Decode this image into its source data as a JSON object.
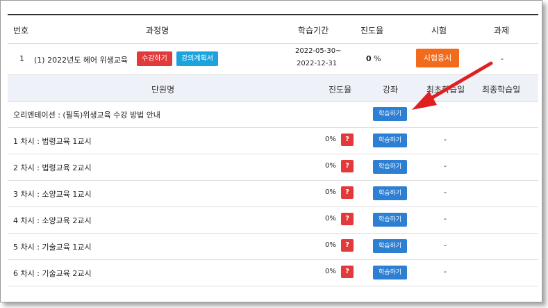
{
  "header": {
    "col_no": "번호",
    "col_course": "과정명",
    "col_period": "학습기간",
    "col_progress": "진도율",
    "col_exam": "시험",
    "col_assignment": "과제"
  },
  "course": {
    "no": "1",
    "name": "(1) 2022년도 헤어 위생교육",
    "enroll_label": "수강하기",
    "plan_label": "강의계획서",
    "period_start": "2022-05-30~",
    "period_end": "2022-12-31",
    "progress_value": "0",
    "progress_unit": " %",
    "exam_label": "시험응시",
    "assignment": "-"
  },
  "units_header": {
    "col_unit": "단원명",
    "col_progress": "진도율",
    "col_lecture": "강좌",
    "col_first": "최초학습일",
    "col_last": "최종학습일"
  },
  "units": [
    {
      "title": "오리엔테이션 : (필독)위생교육 수강 방법 안내",
      "progress": "",
      "study": "학습하기",
      "first": "",
      "last": ""
    },
    {
      "title": "1 차시 :  법령교육 1교시",
      "progress": "0%",
      "help": "?",
      "study": "학습하기",
      "first": "-",
      "last": ""
    },
    {
      "title": "2 차시 :  법령교육 2교시",
      "progress": "0%",
      "help": "?",
      "study": "학습하기",
      "first": "-",
      "last": ""
    },
    {
      "title": "3 차시 :  소양교육 1교시",
      "progress": "0%",
      "help": "?",
      "study": "학습하기",
      "first": "-",
      "last": ""
    },
    {
      "title": "4 차시 :  소양교육 2교시",
      "progress": "0%",
      "help": "?",
      "study": "학습하기",
      "first": "-",
      "last": ""
    },
    {
      "title": "5 차시 :  기술교육 1교시",
      "progress": "0%",
      "help": "?",
      "study": "학습하기",
      "first": "-",
      "last": ""
    },
    {
      "title": "6 차시 :  기술교육 2교시",
      "progress": "0%",
      "help": "?",
      "study": "학습하기",
      "first": "-",
      "last": ""
    }
  ],
  "colors": {
    "red": "#e23a3a",
    "blue": "#2d7fd3",
    "orange": "#f26b1d",
    "cyan": "#1aa3dc",
    "annotation_arrow": "#e02020"
  }
}
